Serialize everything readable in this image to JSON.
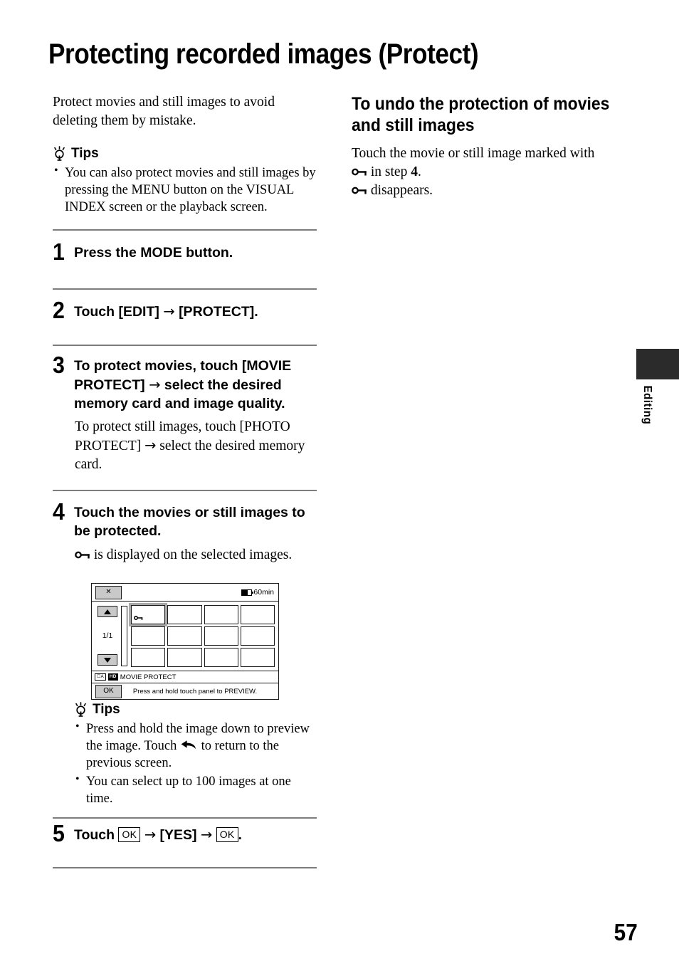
{
  "title": "Protecting recorded images (Protect)",
  "page_number": "57",
  "side_tab": {
    "label": "Editing"
  },
  "left_column": {
    "intro": "Protect movies and still images to avoid deleting them by mistake.",
    "tips_label": "Tips",
    "tips_icon": "lightbulb-icon",
    "tips": [
      "You can also protect movies and still images by pressing the MENU button on the VISUAL INDEX screen or the playback screen."
    ],
    "steps": [
      {
        "number": "1",
        "title": "Press the MODE button."
      },
      {
        "number": "2",
        "title_prefix": "Touch [EDIT]",
        "arrow": "→",
        "title_suffix": "[PROTECT]."
      },
      {
        "number": "3",
        "title_part1": "To protect movies, touch [MOVIE PROTECT]",
        "arrow": "→",
        "title_part2": "select the desired memory card and image quality.",
        "sub_part1": "To protect still images, touch [PHOTO PROTECT]",
        "sub_part2": "select the desired memory card."
      },
      {
        "number": "4",
        "title": "Touch the movies or still images to be protected.",
        "note_icon": "protect-key-icon",
        "note": "is displayed on the selected images."
      },
      {
        "number": "5",
        "touch_label": "Touch",
        "ok_label": "OK",
        "arrow": "→",
        "yes_label": "[YES]",
        "ok_label_2": "OK",
        "period": "."
      }
    ],
    "figure": {
      "close_button": "✕",
      "battery_time": "60min",
      "battery_icon": "battery-icon",
      "up_button": "up-arrow-icon",
      "down_button": "down-arrow-icon",
      "page_indicator": "1/1",
      "thumbnail_count": 12,
      "selected_thumbnail_index": 0,
      "selected_thumbnail_icon": "protect-key-icon",
      "status_mode_glyph": "☐A",
      "status_quality_glyph": "HD",
      "status_label": "MOVIE PROTECT",
      "ok_button": "OK",
      "hint_text": "Press and hold touch panel to PREVIEW."
    },
    "bottom_tips_label": "Tips",
    "bottom_tips": [
      {
        "part1": "Press and hold the image down to preview the image. Touch",
        "icon": "return-arrow-icon",
        "part2": "to return to the previous screen."
      },
      {
        "text": "You can select up to 100 images at one time."
      }
    ]
  },
  "right_column": {
    "heading": "To undo the protection of movies and still images",
    "paragraph_line1": "Touch the movie or still image marked with",
    "paragraph_icon": "protect-key-icon",
    "paragraph_line2_prefix": "in step",
    "paragraph_step_number": "4",
    "paragraph_line2_suffix": ".",
    "paragraph_line3": "disappears."
  }
}
